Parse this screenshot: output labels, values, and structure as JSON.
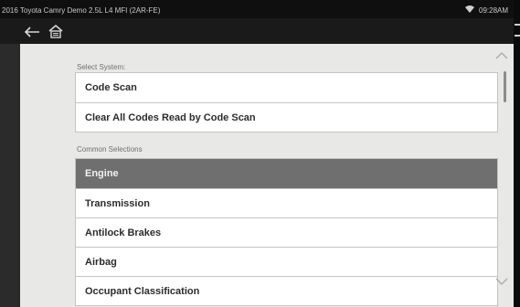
{
  "status_bar": {
    "title": "2016 Toyota Camry Demo 2.5L L4 MFI (2AR-FE)",
    "time": "09:28AM",
    "wifi_icon": "wifi-icon"
  },
  "nav": {
    "back_icon": "back-arrow-icon",
    "home_icon": "home-icon"
  },
  "select_system": {
    "label": "Select System:",
    "items": [
      {
        "label": "Code Scan"
      },
      {
        "label": "Clear All Codes Read by Code Scan"
      }
    ]
  },
  "common_selections": {
    "label": "Common Selections",
    "items": [
      {
        "label": "Engine",
        "selected": true
      },
      {
        "label": "Transmission"
      },
      {
        "label": "Antilock Brakes"
      },
      {
        "label": "Airbag"
      },
      {
        "label": "Occupant Classification"
      }
    ]
  },
  "colors": {
    "selected_row": "#6f6f6f",
    "background": "#e8e8e6",
    "status_bar": "#0f0f0f"
  }
}
